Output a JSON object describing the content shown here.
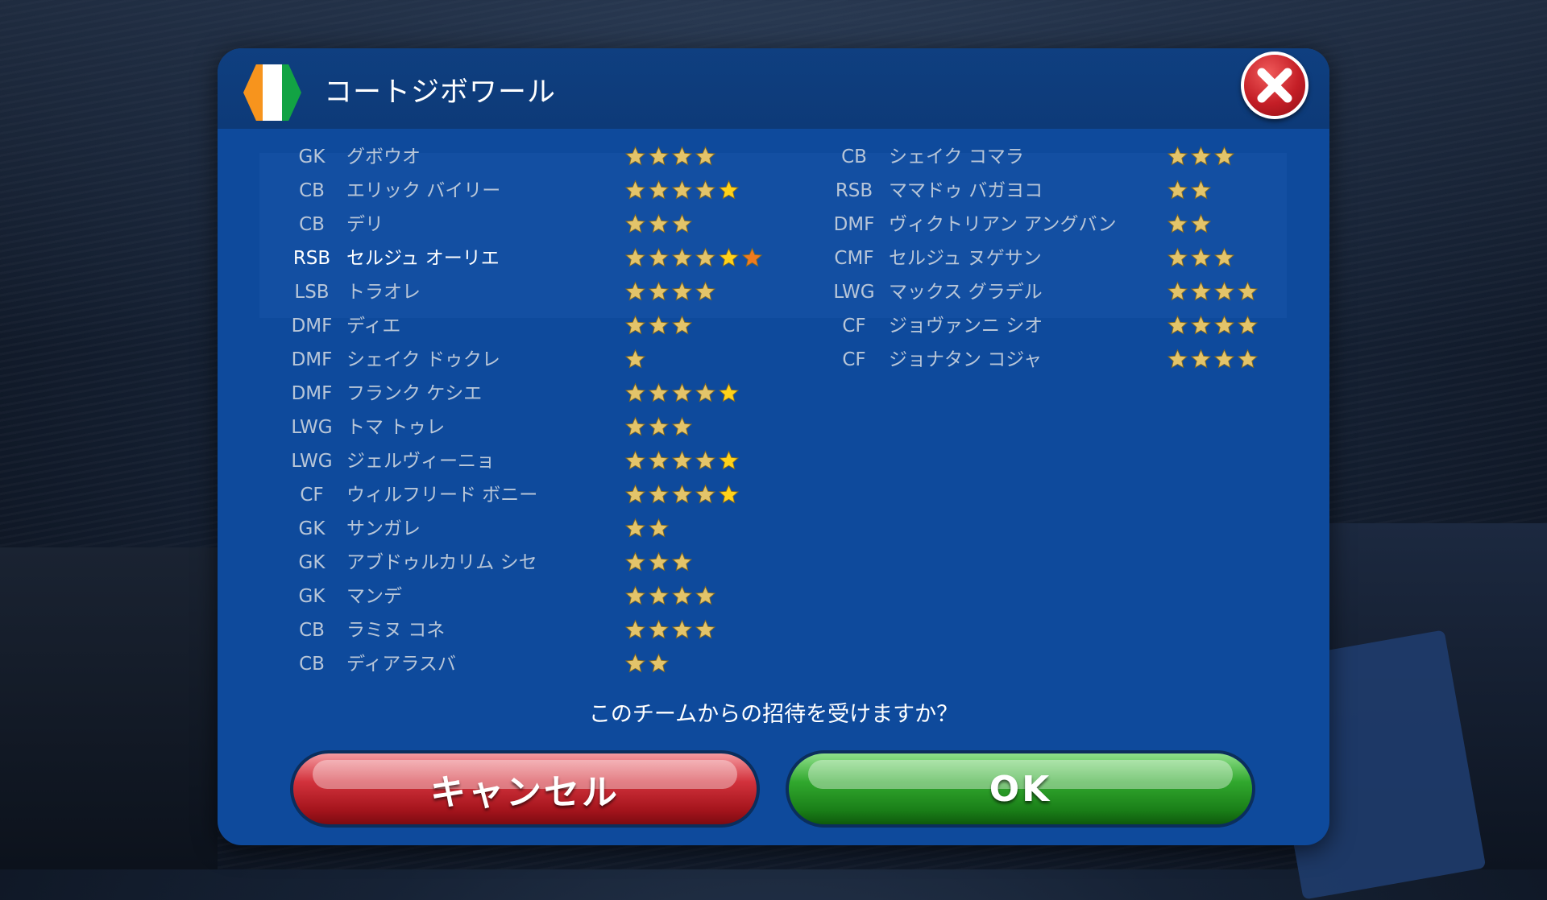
{
  "dialog": {
    "title": "コートジボワール",
    "flag_colors": [
      "#f7941d",
      "#ffffff",
      "#12a344"
    ],
    "close_icon": "close-icon",
    "question": "このチームからの招待を受けますか？",
    "cancel_label": "キャンセル",
    "ok_label": "OK"
  },
  "colors": {
    "star_gold": "#e3c46a",
    "star_yellow": "#ffd21a",
    "star_orange": "#f07a1e"
  },
  "roster": {
    "left": [
      {
        "pos": "GK",
        "name": "グボウオ",
        "stars": 4,
        "extra": ""
      },
      {
        "pos": "CB",
        "name": "エリック バイリー",
        "stars": 5,
        "extra": "yellow"
      },
      {
        "pos": "CB",
        "name": "デリ",
        "stars": 3,
        "extra": ""
      },
      {
        "pos": "RSB",
        "name": "セルジュ オーリエ",
        "stars": 6,
        "extra": "yellow-orange",
        "highlight": true
      },
      {
        "pos": "LSB",
        "name": "トラオレ",
        "stars": 4,
        "extra": ""
      },
      {
        "pos": "DMF",
        "name": "ディエ",
        "stars": 3,
        "extra": ""
      },
      {
        "pos": "DMF",
        "name": "シェイク ドゥクレ",
        "stars": 1,
        "extra": ""
      },
      {
        "pos": "DMF",
        "name": "フランク ケシエ",
        "stars": 5,
        "extra": "yellow"
      },
      {
        "pos": "LWG",
        "name": "トマ トゥレ",
        "stars": 3,
        "extra": ""
      },
      {
        "pos": "LWG",
        "name": "ジェルヴィーニョ",
        "stars": 5,
        "extra": "yellow"
      },
      {
        "pos": "CF",
        "name": "ウィルフリード ボニー",
        "stars": 5,
        "extra": "yellow"
      },
      {
        "pos": "GK",
        "name": "サンガレ",
        "stars": 2,
        "extra": ""
      },
      {
        "pos": "GK",
        "name": "アブドゥルカリム シセ",
        "stars": 3,
        "extra": ""
      },
      {
        "pos": "GK",
        "name": "マンデ",
        "stars": 4,
        "extra": ""
      },
      {
        "pos": "CB",
        "name": "ラミヌ コネ",
        "stars": 4,
        "extra": ""
      },
      {
        "pos": "CB",
        "name": "ディアラスバ",
        "stars": 2,
        "extra": ""
      }
    ],
    "right": [
      {
        "pos": "CB",
        "name": "シェイク コマラ",
        "stars": 3,
        "extra": ""
      },
      {
        "pos": "RSB",
        "name": "ママドゥ バガヨコ",
        "stars": 2,
        "extra": ""
      },
      {
        "pos": "DMF",
        "name": "ヴィクトリアン アングバン",
        "stars": 2,
        "extra": ""
      },
      {
        "pos": "CMF",
        "name": "セルジュ ヌゲサン",
        "stars": 3,
        "extra": ""
      },
      {
        "pos": "LWG",
        "name": "マックス グラデル",
        "stars": 4,
        "extra": ""
      },
      {
        "pos": "CF",
        "name": "ジョヴァンニ シオ",
        "stars": 4,
        "extra": ""
      },
      {
        "pos": "CF",
        "name": "ジョナタン コジャ",
        "stars": 4,
        "extra": ""
      }
    ]
  }
}
